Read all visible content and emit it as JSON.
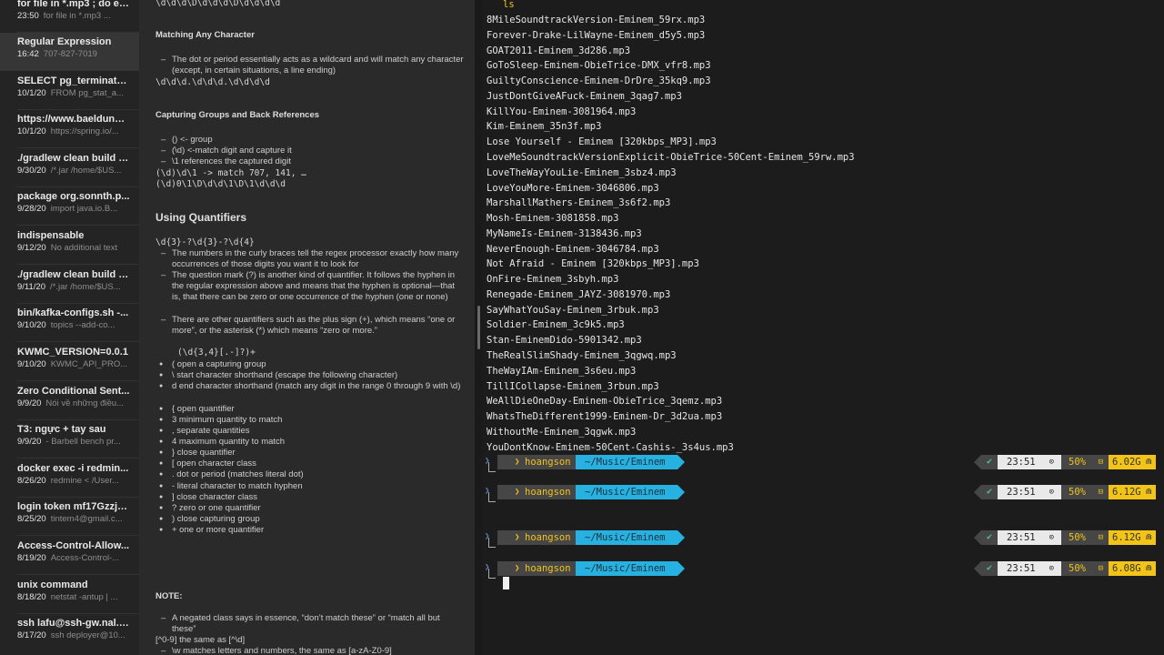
{
  "notes": [
    {
      "title": "for file in *.mp3 ; do ec...",
      "date": "23:50",
      "preview": "for file in *.mp3 ..."
    },
    {
      "title": "Regular Expression",
      "date": "16:42",
      "preview": "707-827-7019",
      "selected": true
    },
    {
      "title": "SELECT pg_terminate_...",
      "date": "10/1/20",
      "preview": "FROM pg_stat_a..."
    },
    {
      "title": "https://www.baeldung....",
      "date": "10/1/20",
      "preview": "https://spring.io/..."
    },
    {
      "title": "./gradlew clean build -...",
      "date": "9/30/20",
      "preview": "/*.jar /home/$US..."
    },
    {
      "title": "package org.sonnth.p...",
      "date": "9/28/20",
      "preview": "import java.io.B..."
    },
    {
      "title": "indispensable",
      "date": "9/12/20",
      "preview": "No additional text"
    },
    {
      "title": "./gradlew clean build -...",
      "date": "9/11/20",
      "preview": "/*.jar /home/$US..."
    },
    {
      "title": "bin/kafka-configs.sh -...",
      "date": "9/10/20",
      "preview": "topics --add-co..."
    },
    {
      "title": "KWMC_VERSION=0.0.1",
      "date": "9/10/20",
      "preview": "KWMC_API_PRO..."
    },
    {
      "title": "Zero Conditional Sent...",
      "date": "9/9/20",
      "preview": "Nói về những điều..."
    },
    {
      "title": "T3: ngực + tay sau",
      "date": "9/9/20",
      "preview": "- Barbell bench pr..."
    },
    {
      "title": "docker exec -i redmin...",
      "date": "8/26/20",
      "preview": "redmine < /User..."
    },
    {
      "title": "login token mf17GzzjR...",
      "date": "8/25/20",
      "preview": "tintem4@gmail.c..."
    },
    {
      "title": "Access-Control-Allow...",
      "date": "8/19/20",
      "preview": "Access-Control-..."
    },
    {
      "title": "unix command",
      "date": "8/18/20",
      "preview": "netstat -antup | ..."
    },
    {
      "title": "ssh lafu@ssh-gw.nal.v...",
      "date": "8/17/20",
      "preview": "ssh deployer@10..."
    }
  ],
  "editor": {
    "top_code": "\\d\\d\\d\\D\\d\\d\\d\\D\\d\\d\\d\\d",
    "h_any_char": "Matching Any Character",
    "any_char_bullet": "The dot or period essentially acts as a wildcard and will match any character (except, in certain situations, a line ending)",
    "any_char_code": "\\d\\d\\d.\\d\\d\\d.\\d\\d\\d\\d",
    "h_groups": "Capturing Groups and Back References",
    "groups_b1": "() <- group",
    "groups_b2": "(\\d) <-match digit and capture it",
    "groups_b3": "\\1 references the captured digit",
    "groups_code1": "(\\d)\\d\\1 -> match 707, 141, …",
    "groups_code2": "(\\d)0\\1\\D\\d\\d\\1\\D\\1\\d\\d\\d",
    "h_quant": "Using Quantifiers",
    "quant_code": "\\d{3}-?\\d{3}-?\\d{4}",
    "quant_b1": "The numbers in the curly braces tell the regex processor exactly how many occurrences of those digits you want it to look for",
    "quant_b2": "The question mark (?) is another kind of quantifier. It follows the hyphen in the regular expression above and means that the hyphen is optional—that is, that there can be zero or one occurrence of the hyphen (one or none)",
    "quant_b3": "There are other quantifiers such as the plus sign (+), which means “one or more”, or the asterisk (*) which means “zero or more.”",
    "pattern": "(\\d{3,4}[.-]?)+",
    "dots": [
      "( open a capturing group",
      "\\ start character shorthand (escape the following character)",
      "d end character shorthand (match any digit in the range 0 through 9 with \\d)",
      "{ open quantifier",
      "3 minimum quantity to match",
      ", separate quantities",
      "4 maximum quantity to match",
      "} close quantifier",
      "[ open character class",
      ". dot or period (matches literal dot)",
      "- literal character to match hyphen",
      "] close character class",
      "? zero or one quantifier",
      ") close capturing group",
      "+ one or more quantifier"
    ],
    "note_heading": "NOTE:",
    "note_b1": "A negated class says in essence, “don’t match these” or “match all but these”",
    "note_code": "[^0-9]  the same as [^\\d]",
    "note_b2": "\\w matches letters and numbers, the same as [a-zA-Z0-9]"
  },
  "terminal": {
    "command": "ls",
    "files": [
      "8MileSoundtrackVersion-Eminem_59rx.mp3",
      "Forever-Drake-LilWayne-Eminem_d5y5.mp3",
      "GOAT2011-Eminem_3d286.mp3",
      "GoToSleep-Eminem-ObieTrice-DMX_vfr8.mp3",
      "GuiltyConscience-Eminem-DrDre_35kq9.mp3",
      "JustDontGiveAFuck-Eminem_3qag7.mp3",
      "KillYou-Eminem-3081964.mp3",
      "Kim-Eminem_35n3f.mp3",
      "Lose Yourself - Eminem [320kbps_MP3].mp3",
      "LoveMeSoundtrackVersionExplicit-ObieTrice-50Cent-Eminem_59rw.mp3",
      "LoveTheWayYouLie-Eminem_3sbz4.mp3",
      "LoveYouMore-Eminem-3046806.mp3",
      "MarshallMathers-Eminem_3s6f2.mp3",
      "Mosh-Eminem-3081858.mp3",
      "MyNameIs-Eminem-3138436.mp3",
      "NeverEnough-Eminem-3046784.mp3",
      "Not Afraid - Eminem [320kbps_MP3].mp3",
      "OnFire-Eminem_3sbyh.mp3",
      "Renegade-Eminem_JAYZ-3081970.mp3",
      "SayWhatYouSay-Eminem_3rbuk.mp3",
      "Soldier-Eminem_3c9k5.mp3",
      "Stan-EminemDido-5901342.mp3",
      "TheRealSlimShady-Eminem_3qgwq.mp3",
      "TheWayIAm-Eminem_3s6eu.mp3",
      "TillICollapse-Eminem_3rbun.mp3",
      "WeAllDieOneDay-Eminem-ObieTrice_3qemz.mp3",
      "WhatsTheDifferent1999-Eminem-Dr_3d2ua.mp3",
      "WithoutMe-Eminem_3qgwk.mp3",
      "YouDontKnow-Eminem-50Cent-Cashis-_3s4us.mp3"
    ],
    "prompts": [
      {
        "user": "hoangson",
        "path": "~/Music/Eminem",
        "time": "23:51",
        "battery": "50%",
        "memory": "6.02G"
      },
      {
        "user": "hoangson",
        "path": "~/Music/Eminem",
        "time": "23:51",
        "battery": "50%",
        "memory": "6.12G"
      },
      {
        "user": "hoangson",
        "path": "~/Music/Eminem",
        "time": "23:51",
        "battery": "50%",
        "memory": "6.12G"
      },
      {
        "user": "hoangson",
        "path": "~/Music/Eminem",
        "time": "23:51",
        "battery": "50%",
        "memory": "6.08G"
      }
    ],
    "colors": {
      "path_segment": "#27b1e0",
      "user_text": "#f2c318",
      "memory_segment": "#f2c318",
      "check": "#4fc18a"
    }
  }
}
